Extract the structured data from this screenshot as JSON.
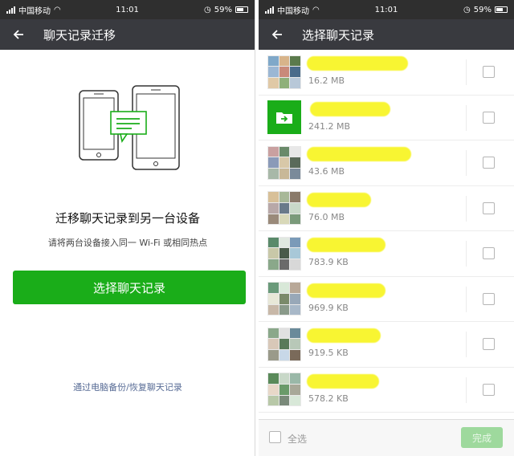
{
  "status_bar": {
    "carrier": "中国移动",
    "time": "11:01",
    "battery": "59%"
  },
  "left_screen": {
    "title": "聊天记录迁移",
    "heading": "迁移聊天记录到另一台设备",
    "subtext": "请将两台设备接入同一 Wi-Fi 或相同热点",
    "primary_button": "选择聊天记录",
    "backup_link": "通过电脑备份/恢复聊天记录",
    "accent_color": "#1aad19"
  },
  "right_screen": {
    "title": "选择聊天记录",
    "chats": [
      {
        "size": "16.2 MB",
        "name_hidden": true
      },
      {
        "size": "241.2 MB",
        "name_hidden": true,
        "icon": "folder-arrow-icon"
      },
      {
        "size": "43.6 MB",
        "name_hidden": true
      },
      {
        "size": "76.0 MB",
        "name_hidden": true
      },
      {
        "size": "783.9 KB",
        "name_hidden": true
      },
      {
        "size": "969.9 KB",
        "name_hidden": true
      },
      {
        "size": "919.5 KB",
        "name_hidden": true
      },
      {
        "size": "578.2 KB",
        "name_hidden": true
      }
    ],
    "footer": {
      "select_all": "全选",
      "done": "完成"
    }
  }
}
